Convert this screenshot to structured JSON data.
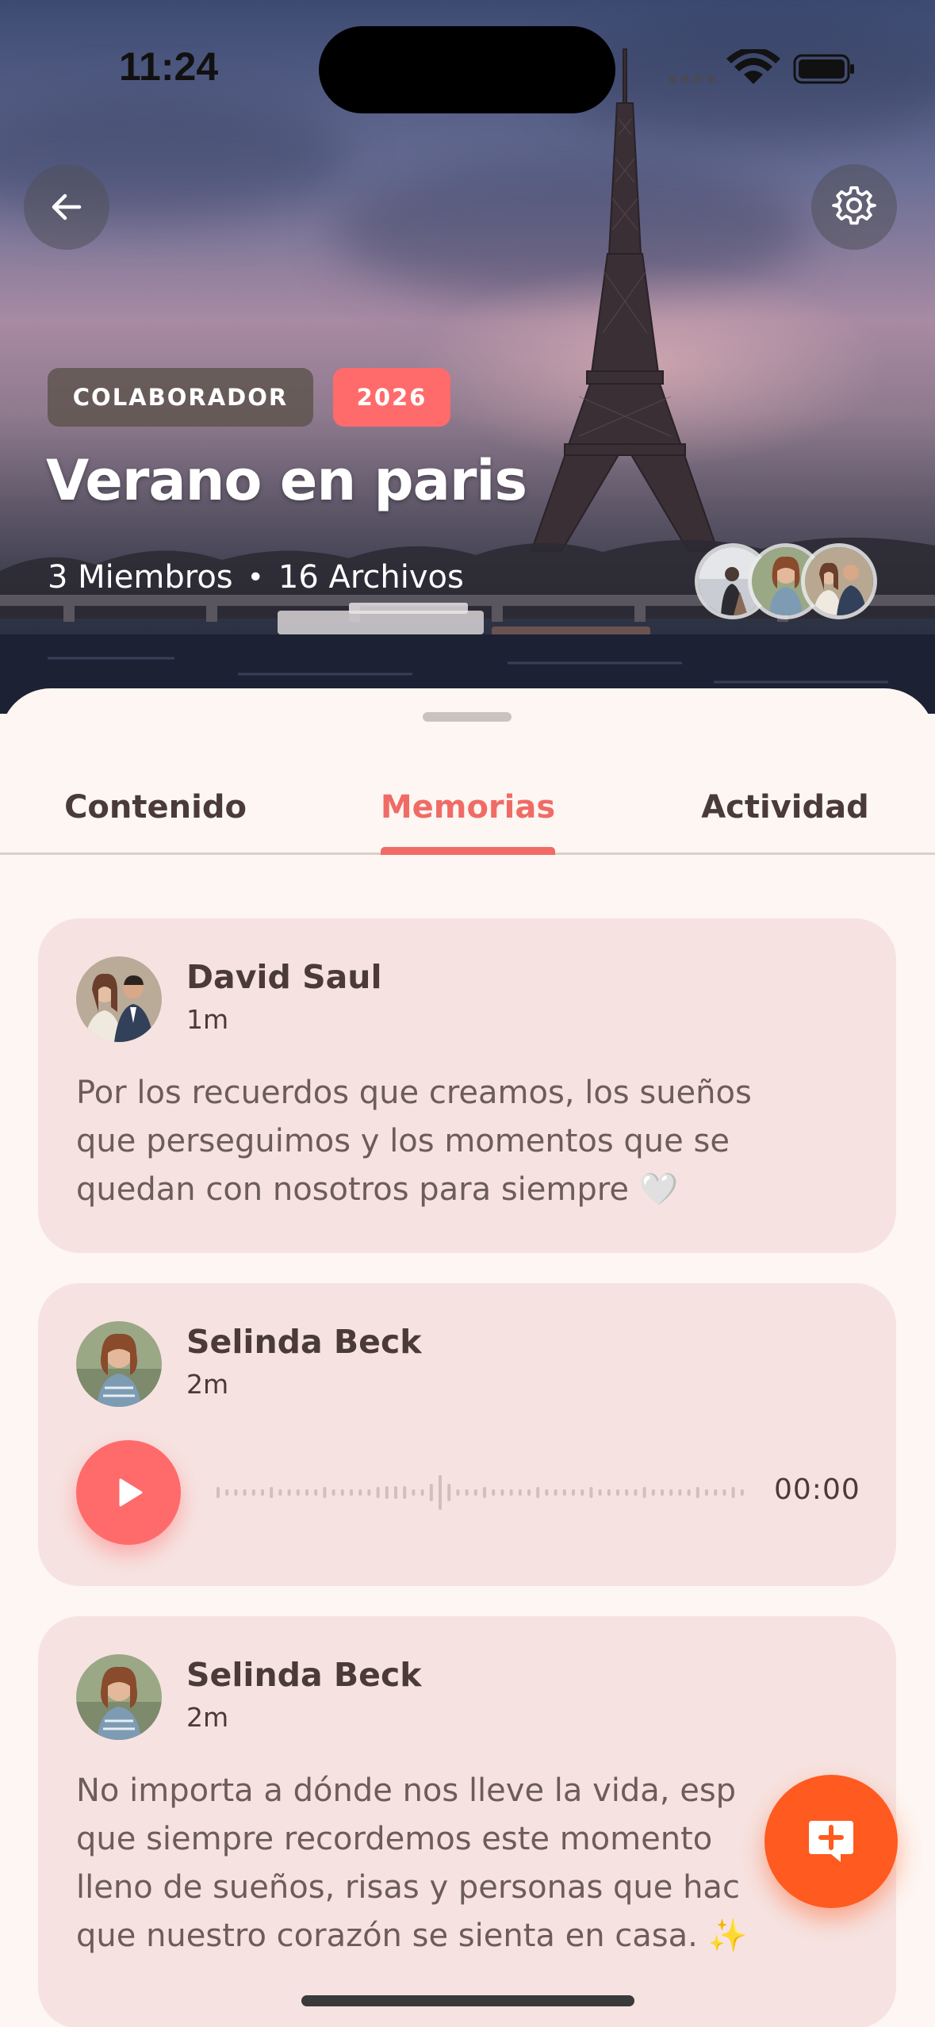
{
  "status_bar": {
    "time": "11:24"
  },
  "hero": {
    "tags": {
      "role": "COLABORADOR",
      "year": "2026"
    },
    "title": "Verano en paris",
    "members": "3 Miembros",
    "separator": "•",
    "files": "16 Archivos"
  },
  "tabs": [
    {
      "label": "Contenido",
      "active": false
    },
    {
      "label": "Memorias",
      "active": true
    },
    {
      "label": "Actividad",
      "active": false
    }
  ],
  "posts": [
    {
      "author": "David Saul",
      "time": "1m",
      "type": "text",
      "text": "Por los recuerdos que creamos, los sueños\nque perseguimos y los momentos que se\nquedan con nosotros para siempre 🤍"
    },
    {
      "author": "Selinda Beck",
      "time": "2m",
      "type": "audio",
      "duration": "00:00"
    },
    {
      "author": "Selinda Beck",
      "time": "2m",
      "type": "text",
      "text": "No importa a dónde nos lleve la vida, esp\nque siempre recordemos este momento\nlleno de sueños, risas y personas que hac\nque nuestro corazón se sienta en casa. ✨"
    }
  ],
  "colors": {
    "accent": "#ff6b6b",
    "tab_active": "#f06b66",
    "fab": "#ff5a1f",
    "card_bg": "#f6e3e1",
    "sheet_bg": "#fdf6f2"
  },
  "icons": {
    "back": "arrow-left-icon",
    "settings": "gear-icon",
    "play": "play-icon",
    "fab": "message-plus-icon"
  }
}
